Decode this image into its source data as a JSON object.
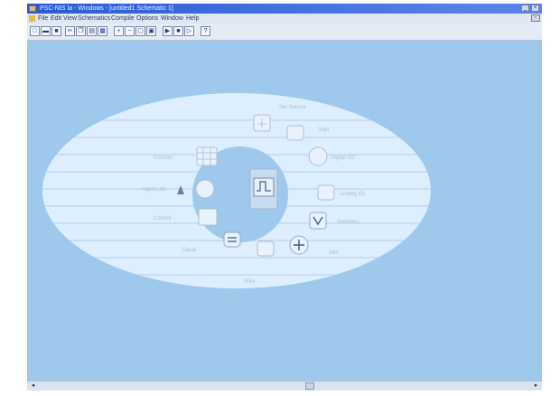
{
  "window": {
    "title": "PSC-NIS Ia - Windows - [untitled1 Schematic 1]"
  },
  "menu": {
    "items": [
      "File",
      "Edit",
      "View",
      "Schematics",
      "Compile",
      "Options",
      "Window",
      "Help"
    ]
  },
  "toolbar": {
    "buttons": [
      "new",
      "open",
      "save",
      "cut",
      "copy",
      "paste",
      "print",
      "zoom-in",
      "zoom-out",
      "zoom-fit",
      "zoom-area",
      "run",
      "stop",
      "step",
      "help"
    ]
  },
  "wheel": {
    "modules": [
      {
        "key": "set_source",
        "label": "Set Source",
        "icon": "source-plug-icon"
      },
      {
        "key": "start",
        "label": "Start",
        "icon": "start-clock-icon"
      },
      {
        "key": "digital_io",
        "label": "Digital I/O",
        "icon": "digital-io-icon"
      },
      {
        "key": "analog_io",
        "label": "Analog I/O",
        "icon": "analog-io-icon"
      },
      {
        "key": "variables",
        "label": "Variables",
        "icon": "variables-icon"
      },
      {
        "key": "add",
        "label": "Add",
        "icon": "plus-icon"
      },
      {
        "key": "wire",
        "label": "Wire",
        "icon": "wire-icon"
      },
      {
        "key": "equal",
        "label": "Equal",
        "icon": "equal-icon"
      },
      {
        "key": "control",
        "label": "Control",
        "icon": "control-icon"
      },
      {
        "key": "input_lab",
        "label": "Input Lab",
        "icon": "input-lab-icon"
      },
      {
        "key": "counter",
        "label": "Counter",
        "icon": "counter-grid-icon"
      }
    ],
    "center_icon": "signal-waveform-icon"
  },
  "colors": {
    "workspace": "#9ec8ec",
    "ellipse": "#ddeeff",
    "center_circle": "#9ec8ec",
    "titlebar": "#2a5bd6"
  }
}
